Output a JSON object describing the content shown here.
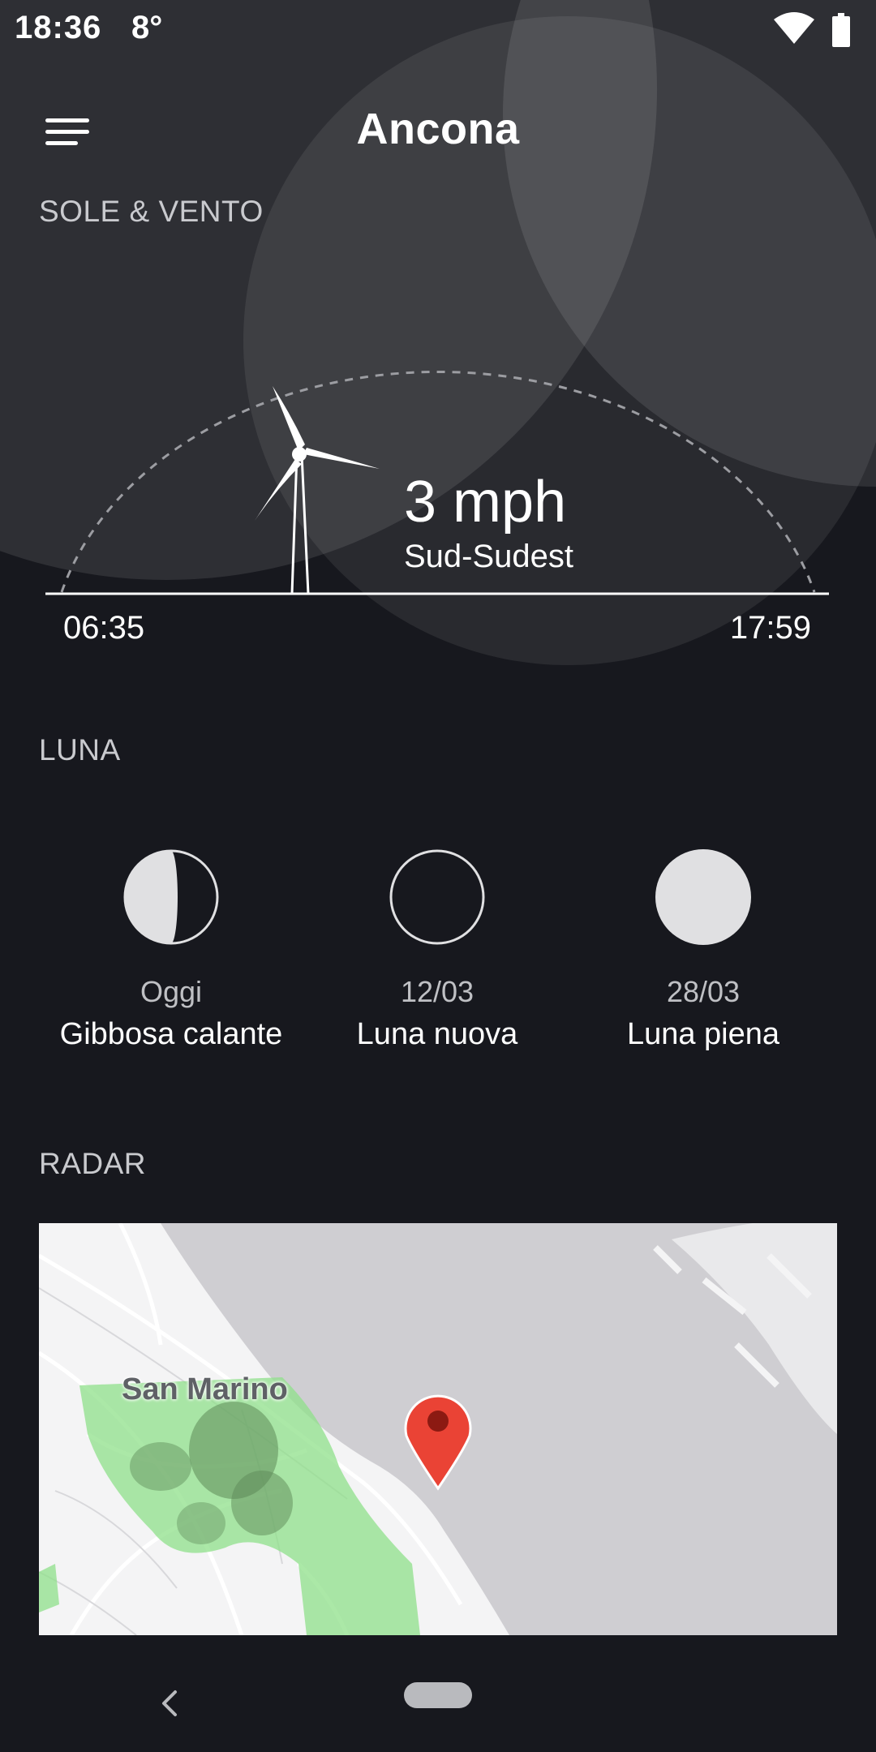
{
  "status_bar": {
    "time": "18:36",
    "temperature": "8°",
    "wifi_icon": "wifi-icon",
    "battery_icon": "battery-icon"
  },
  "toolbar": {
    "menu_icon": "hamburger-menu-icon",
    "title": "Ancona"
  },
  "sun_wind": {
    "section_label": "SOLE & VENTO",
    "wind_icon": "wind-turbine-icon",
    "wind_speed": "3 mph",
    "wind_direction": "Sud-Sudest",
    "sunrise": "06:35",
    "sunset": "17:59"
  },
  "moon": {
    "section_label": "LUNA",
    "phases": [
      {
        "date": "Oggi",
        "name": "Gibbosa calante",
        "icon": "waning-gibbous-moon-icon"
      },
      {
        "date": "12/03",
        "name": "Luna nuova",
        "icon": "new-moon-icon"
      },
      {
        "date": "28/03",
        "name": "Luna piena",
        "icon": "full-moon-icon"
      }
    ]
  },
  "radar": {
    "section_label": "RADAR",
    "map_label": "San Marino",
    "pin_icon": "map-pin-icon"
  },
  "nav_bar": {
    "back_icon": "back-icon",
    "home_icon": "home-pill-icon"
  },
  "colors": {
    "background": "#17181e",
    "circle_overlay": "#3a3b41",
    "moon_fill": "#e0e0e2",
    "rain_green": "#8fe08a",
    "rain_dark": "#5d8a58",
    "pin_red": "#ea4335",
    "sea": "#cfced2",
    "land": "#f4f4f5"
  }
}
